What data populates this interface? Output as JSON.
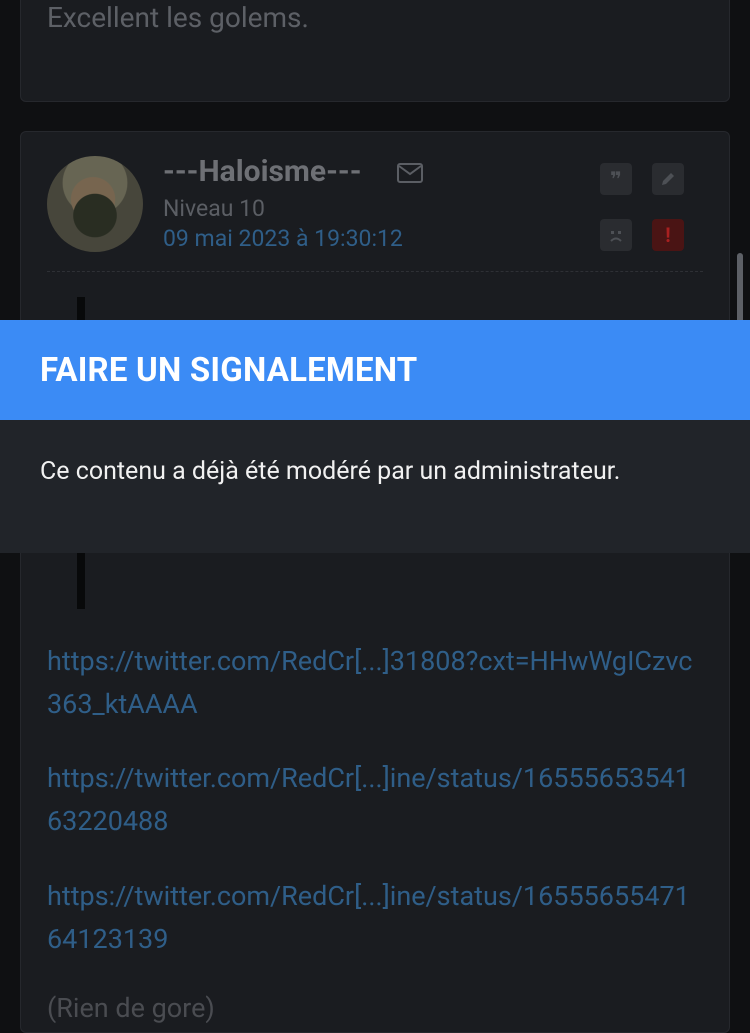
{
  "previous_post": {
    "text": "Excellent les golems."
  },
  "post": {
    "author": "---Haloisme---",
    "level": "Niveau 10",
    "date": "09 mai 2023 à 19:30:12",
    "actions": {
      "quote_icon": "quote-icon",
      "edit_icon": "pencil-icon",
      "frown_icon": "frown-icon",
      "report_icon": "exclamation-icon"
    },
    "links": [
      "https://twitter.com/RedCr[...]31808?cxt=HHwWgICzvc363_ktAAAA",
      "https://twitter.com/RedCr[...]ine/status/1655565354163220488",
      "https://twitter.com/RedCr[...]ine/status/1655565547164123139"
    ],
    "trailing_text": "(Rien de gore)"
  },
  "modal": {
    "title": "FAIRE UN SIGNALEMENT",
    "message": "Ce contenu a déjà été modéré par un administrateur."
  },
  "colors": {
    "modal_header": "#3b8bf5",
    "link": "#2f5e88",
    "report_accent": "#a82020"
  }
}
